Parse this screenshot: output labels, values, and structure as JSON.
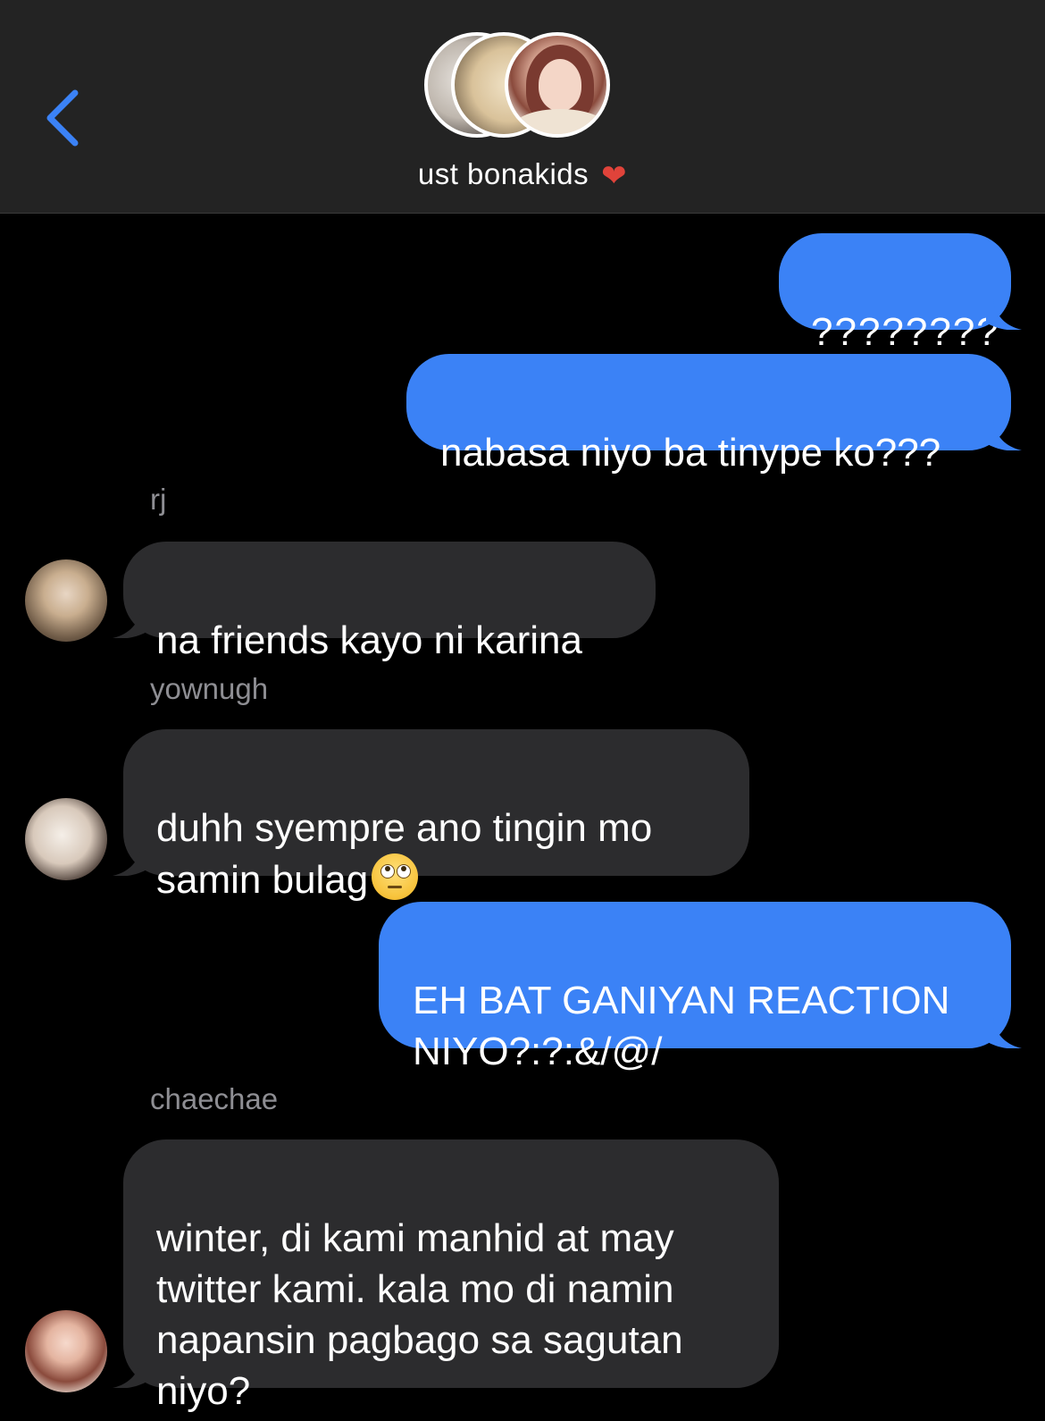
{
  "header": {
    "back_icon": "chevron-left-icon",
    "group_name": "ust bonakids",
    "group_emoji": "heart-on-fire-emoji",
    "accent_color": "#3b82f6"
  },
  "messages": [
    {
      "sender": "me",
      "text": "????????"
    },
    {
      "sender": "me",
      "text": "nabasa niyo ba tinype ko???"
    },
    {
      "sender": "rj",
      "sender_label": "rj",
      "text": "na friends kayo ni karina"
    },
    {
      "sender": "yownugh",
      "sender_label": "yownugh",
      "text": "duhh syempre ano tingin mo\nsamin bulag",
      "emoji": "face-with-rolling-eyes-emoji"
    },
    {
      "sender": "me",
      "text": "EH BAT GANIYAN REACTION\nNIYO?:?:&/@/"
    },
    {
      "sender": "chaechae",
      "sender_label": "chaechae",
      "text": "winter, di kami manhid at may\ntwitter kami. kala mo di namin\nnapansin pagbago sa sagutan\nniyo?"
    }
  ],
  "colors": {
    "sent_bubble": "#3b82f6",
    "received_bubble": "#2c2c2e",
    "sender_label": "#8e8e93",
    "header_bg": "#232323"
  }
}
